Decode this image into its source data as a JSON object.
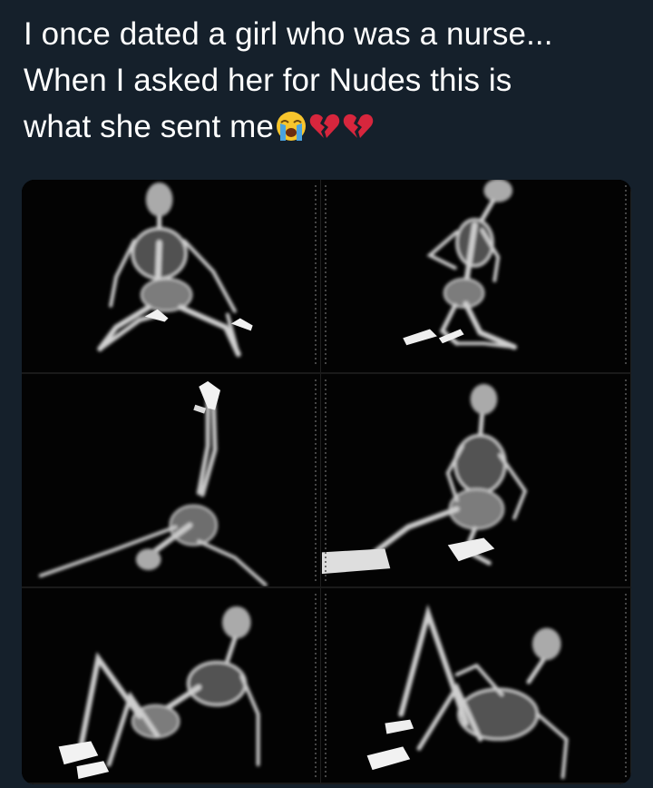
{
  "tweet": {
    "lines": [
      "I once dated a girl who was a nurse...",
      "When I asked her for Nudes this is",
      "what she sent me"
    ],
    "emojis": [
      "loudly-crying-face",
      "broken-heart",
      "broken-heart"
    ]
  },
  "colors": {
    "background": "#15202b",
    "text": "#ffffff",
    "broken_heart": "#d7263d",
    "crying_face": "#f7c52d",
    "tears": "#4aa3df"
  },
  "media": {
    "panels": [
      "xray-kneeling-pose",
      "xray-side-kneel-pose",
      "xray-legs-up-pose",
      "xray-sitting-pose",
      "xray-reclining-pose",
      "xray-lying-pose"
    ]
  }
}
